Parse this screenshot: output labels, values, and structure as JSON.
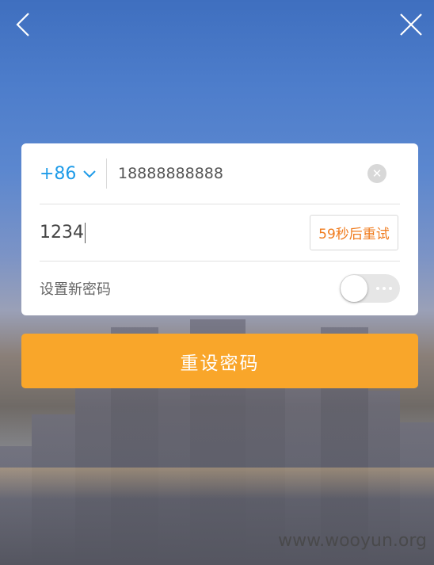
{
  "phone": {
    "country_code": "+86",
    "number": "18888888888"
  },
  "verification": {
    "code": "1234",
    "resend_label": "59秒后重试"
  },
  "new_password": {
    "label": "设置新密码",
    "toggle_on": false
  },
  "submit_label": "重设密码",
  "watermark": "www.wooyun.org",
  "colors": {
    "accent": "#1e9be8",
    "submit": "#f9a62a",
    "resend": "#f07b1d"
  },
  "icons": {
    "back": "back-arrow-icon",
    "close": "close-icon",
    "dropdown": "chevron-down-icon",
    "clear": "clear-icon"
  }
}
